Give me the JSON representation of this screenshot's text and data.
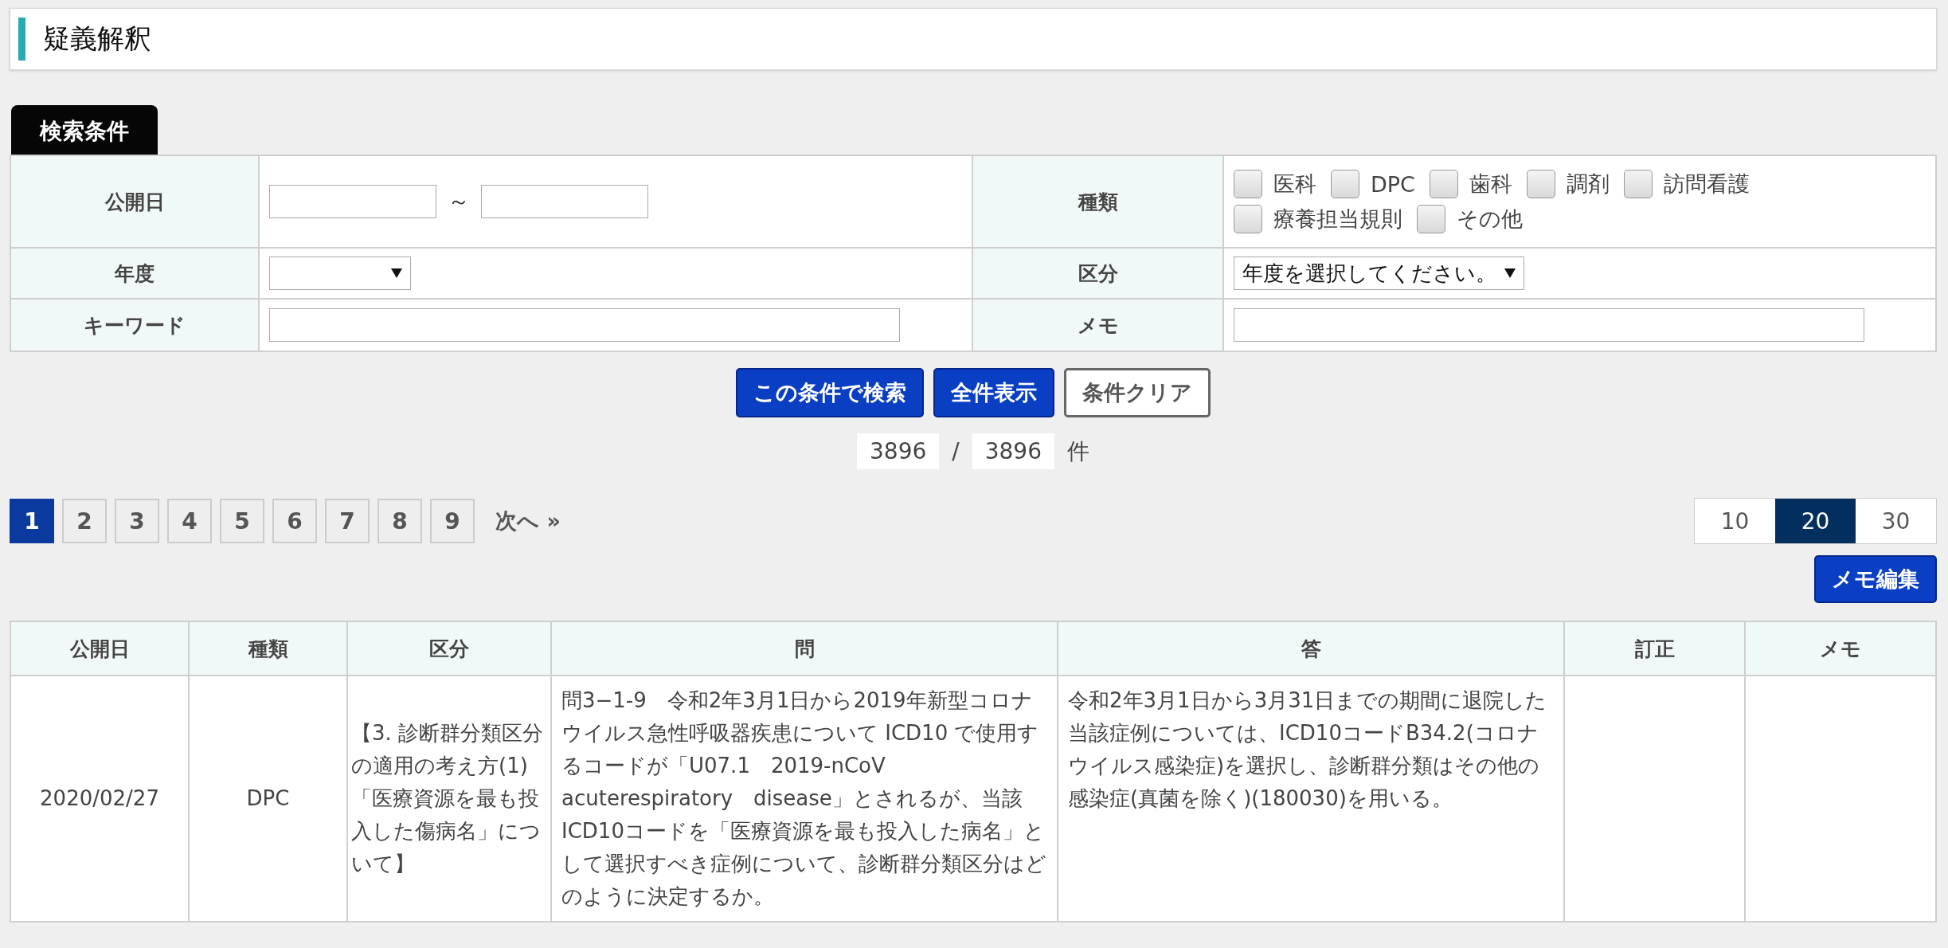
{
  "page_title": "疑義解釈",
  "search_tab": "検索条件",
  "form": {
    "published": {
      "label": "公開日",
      "separator": "～"
    },
    "year": {
      "label": "年度"
    },
    "keyword": {
      "label": "キーワード"
    },
    "types": {
      "label": "種類",
      "options": [
        {
          "label": "医科",
          "checked": false
        },
        {
          "label": "DPC",
          "checked": false
        },
        {
          "label": "歯科",
          "checked": false
        },
        {
          "label": "調剤",
          "checked": false
        },
        {
          "label": "訪問看護",
          "checked": false
        },
        {
          "label": "療養担当規則",
          "checked": false
        },
        {
          "label": "その他",
          "checked": false
        }
      ]
    },
    "category": {
      "label": "区分",
      "value": "年度を選択してください。"
    },
    "memo": {
      "label": "メモ"
    }
  },
  "buttons": [
    {
      "label": "この条件で検索",
      "kind": "primary"
    },
    {
      "label": "全件表示",
      "kind": "primary"
    },
    {
      "label": "条件クリア",
      "kind": "outline"
    }
  ],
  "count": {
    "shown": "3896",
    "separator": "/",
    "total": "3896",
    "unit": "件"
  },
  "pagination": {
    "pages": [
      {
        "label": "1",
        "selected": true
      },
      {
        "label": "2",
        "selected": false
      },
      {
        "label": "3",
        "selected": false
      },
      {
        "label": "4",
        "selected": false
      },
      {
        "label": "5",
        "selected": false
      },
      {
        "label": "6",
        "selected": false
      },
      {
        "label": "7",
        "selected": false
      },
      {
        "label": "8",
        "selected": false
      },
      {
        "label": "9",
        "selected": false
      }
    ],
    "next": "次へ »"
  },
  "per_page": [
    {
      "label": "10",
      "selected": false
    },
    {
      "label": "20",
      "selected": true
    },
    {
      "label": "30",
      "selected": false
    }
  ],
  "memo_edit_button": "メモ編集",
  "table": {
    "columns": [
      "公開日",
      "種類",
      "区分",
      "問",
      "答",
      "訂正",
      "メモ"
    ],
    "rows": [
      [
        "2020/02/27",
        "DPC",
        "【3. 診断群分類区分の適用の考え方(1)「医療資源を最も投入した傷病名」について】",
        "問3−1-9　令和2年3月1日から2019年新型コロナウイルス急性呼吸器疾患について ICD10 で使用するコードが「U07.1　2019-nCoV acuterespiratory　disease」とされるが、当該ICD10コードを「医療資源を最も投入した病名」として選択すべき症例について、診断群分類区分はどのように決定するか。",
        "令和2年3月1日から3月31日までの期間に退院した当該症例については、ICD10コードB34.2(コロナウイルス感染症)を選択し、診断群分類はその他の感染症(真菌を除く)(180030)を用いる。",
        "",
        ""
      ]
    ]
  }
}
